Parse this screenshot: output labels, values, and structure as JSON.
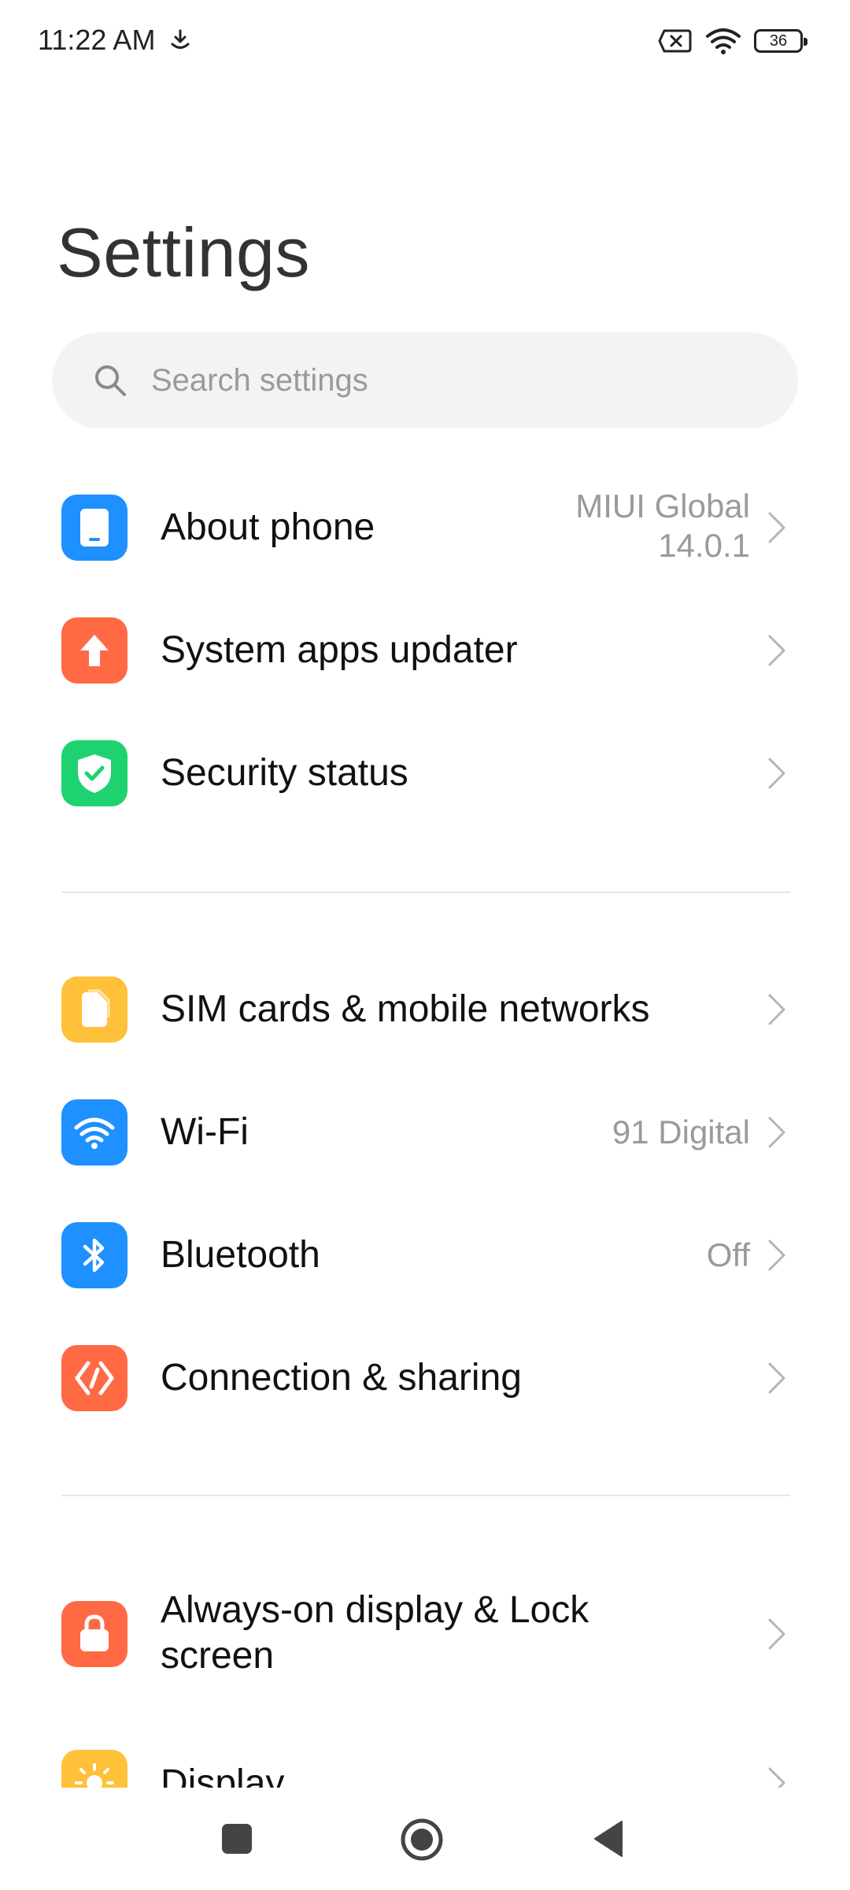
{
  "status_bar": {
    "time": "11:22 AM",
    "battery": "36"
  },
  "title": "Settings",
  "search": {
    "placeholder": "Search settings"
  },
  "groups": [
    [
      {
        "label": "About phone",
        "value_line1": "MIUI Global",
        "value_line2": "14.0.1",
        "icon": "phone-icon",
        "color": "#1E90FF"
      },
      {
        "label": "System apps updater",
        "icon": "arrow-up-icon",
        "color": "#FF6A45"
      },
      {
        "label": "Security status",
        "icon": "shield-check-icon",
        "color": "#1ED36F"
      }
    ],
    [
      {
        "label": "SIM cards & mobile networks",
        "icon": "sim-card-icon",
        "color": "#FFC03A"
      },
      {
        "label": "Wi-Fi",
        "value": "91 Digital",
        "icon": "wifi-icon",
        "color": "#1E90FF"
      },
      {
        "label": "Bluetooth",
        "value": "Off",
        "icon": "bluetooth-icon",
        "color": "#1E90FF"
      },
      {
        "label": "Connection & sharing",
        "icon": "connection-icon",
        "color": "#FF6A45"
      }
    ],
    [
      {
        "label_line1": "Always-on display & Lock",
        "label_line2": "screen",
        "icon": "lock-icon",
        "color": "#FF6A45"
      },
      {
        "label": "Display",
        "icon": "sun-icon",
        "color": "#FFC03A"
      }
    ]
  ],
  "nav": {
    "icons": [
      "recents-icon",
      "home-icon",
      "back-icon"
    ]
  }
}
